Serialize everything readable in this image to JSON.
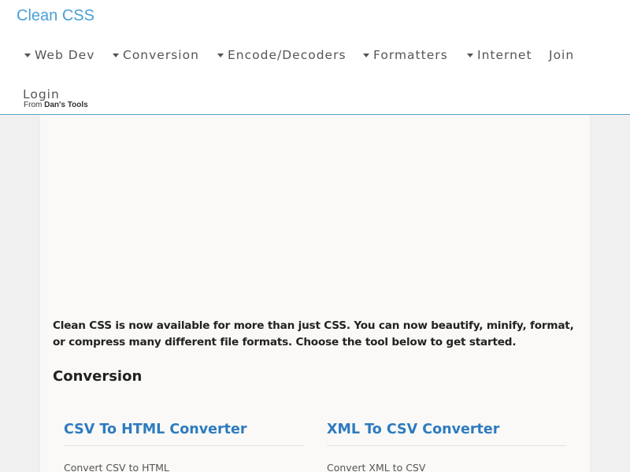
{
  "header": {
    "brand": "Clean CSS",
    "nav": [
      {
        "label": "Web Dev",
        "has_caret": true
      },
      {
        "label": "Conversion",
        "has_caret": true
      },
      {
        "label": "Encode/Decoders",
        "has_caret": true
      },
      {
        "label": "Formatters",
        "has_caret": true
      },
      {
        "label": "Internet",
        "has_caret": true
      },
      {
        "label": "Join",
        "has_caret": false
      },
      {
        "label": "Login",
        "has_caret": false
      }
    ],
    "from_prefix": "From",
    "from_brand": "Dan's Tools"
  },
  "main": {
    "intro": "Clean CSS is now available for more than just CSS. You can now beautify, minify, format, or compress many different file formats. Choose the tool below to get started.",
    "section_title": "Conversion",
    "cards": [
      {
        "title": "CSV To HTML Converter",
        "description": "Convert CSV to HTML"
      },
      {
        "title": "XML To CSV Converter",
        "description": "Convert XML to CSV"
      }
    ]
  },
  "colors": {
    "brand": "#4a9fd8",
    "link": "#2e7bbf",
    "header_border": "#5aa1c8",
    "page_bg": "#f0f0f0",
    "content_bg": "#faf9f7"
  }
}
